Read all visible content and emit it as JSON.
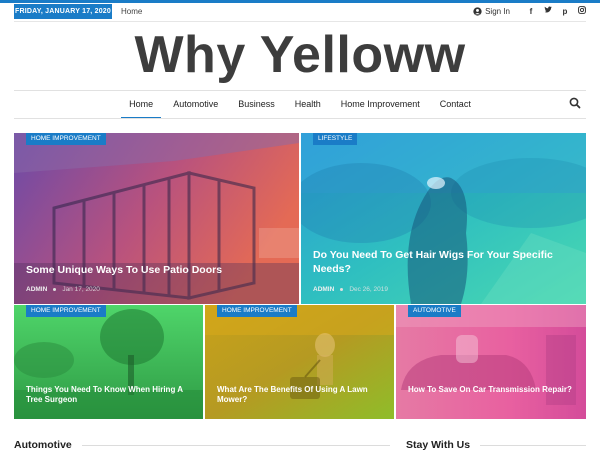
{
  "topbar": {
    "date": "FRIDAY, JANUARY 17, 2020",
    "home_link": "Home",
    "sign_in": "Sign In",
    "socials": [
      "facebook-icon",
      "twitter-icon",
      "pinterest-icon",
      "instagram-icon"
    ]
  },
  "logo": "Why Yelloww",
  "nav": {
    "items": [
      "Home",
      "Automotive",
      "Business",
      "Health",
      "Home Improvement",
      "Contact"
    ],
    "active": "Home"
  },
  "colors": {
    "accent": "#1a7cc7",
    "logo": "#3d3d3d"
  },
  "featured": [
    {
      "category": "HOME IMPROVEMENT",
      "title": "Some Unique Ways To Use Patio Doors",
      "author": "ADMIN",
      "date": "Jan 17, 2020"
    },
    {
      "category": "LIFESTYLE",
      "title": "Do You Need To Get Hair Wigs For Your Specific Needs?",
      "author": "ADMIN",
      "date": "Dec 26, 2019"
    },
    {
      "category": "HOME IMPROVEMENT",
      "title": "Things You Need To Know When Hiring A Tree Surgeon"
    },
    {
      "category": "HOME IMPROVEMENT",
      "title": "What Are The Benefits Of Using A Lawn Mower?"
    },
    {
      "category": "AUTOMOTIVE",
      "title": "How To Save On Car Transmission Repair?"
    }
  ],
  "sections": {
    "left": "Automotive",
    "right": "Stay With Us"
  }
}
